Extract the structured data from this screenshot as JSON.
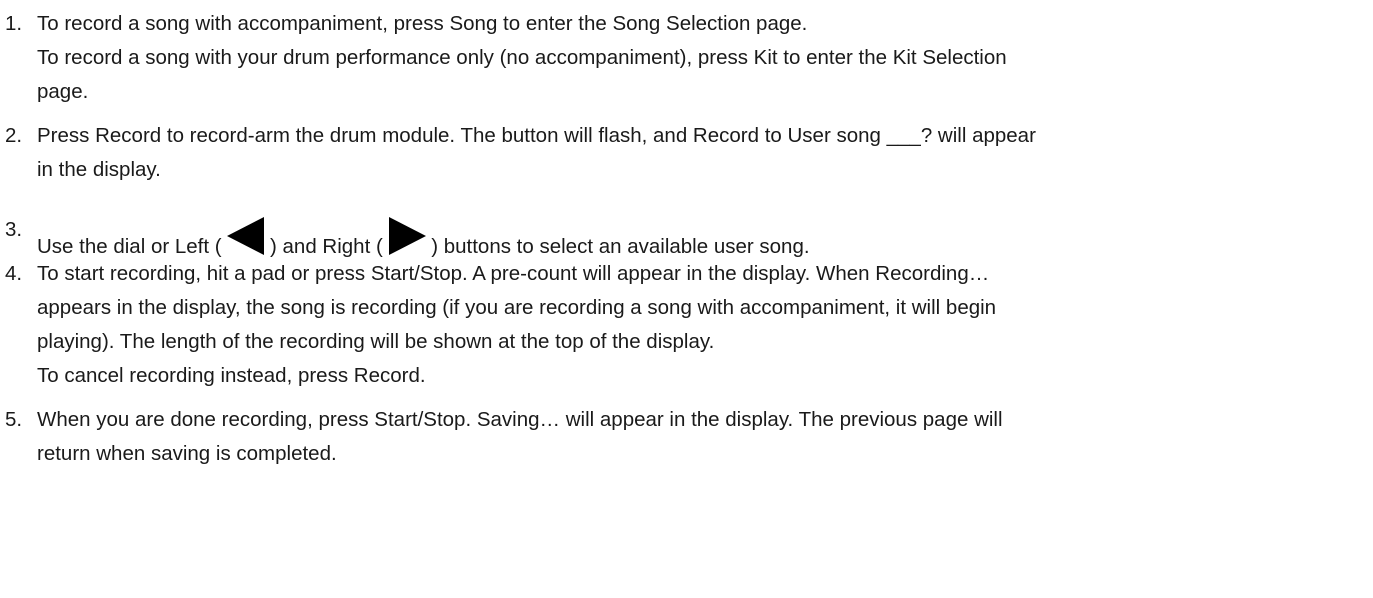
{
  "steps": [
    {
      "number": "1.",
      "lines": [
        "To record a song with accompaniment, press Song to enter the Song Selection page.",
        "To record a song with your drum performance only (no accompaniment), press Kit to enter the Kit Selection",
        "page."
      ]
    },
    {
      "number": "2.",
      "lines": [
        "Press Record to record-arm the drum module. The button will flash, and Record to User song ___? will appear",
        "in the display."
      ]
    },
    {
      "number": "3.",
      "parts": {
        "before_left": "Use the dial or Left (",
        "between": ") and Right (",
        "after_right": ") buttons to select an available user song."
      },
      "icons": [
        "left-arrow-icon",
        "right-arrow-icon"
      ]
    },
    {
      "number": "4.",
      "lines": [
        "To start recording, hit a pad or press Start/Stop. A pre-count will appear in the display. When Recording…",
        "appears in the display, the song is recording (if you are recording a song with accompaniment, it will begin",
        "playing). The length of the recording will be shown at the top of the display.",
        "To cancel recording instead, press Record."
      ]
    },
    {
      "number": "5.",
      "lines": [
        "When you are done recording, press Start/Stop. Saving… will appear in the display. The previous page will",
        "return when saving is completed."
      ]
    }
  ]
}
